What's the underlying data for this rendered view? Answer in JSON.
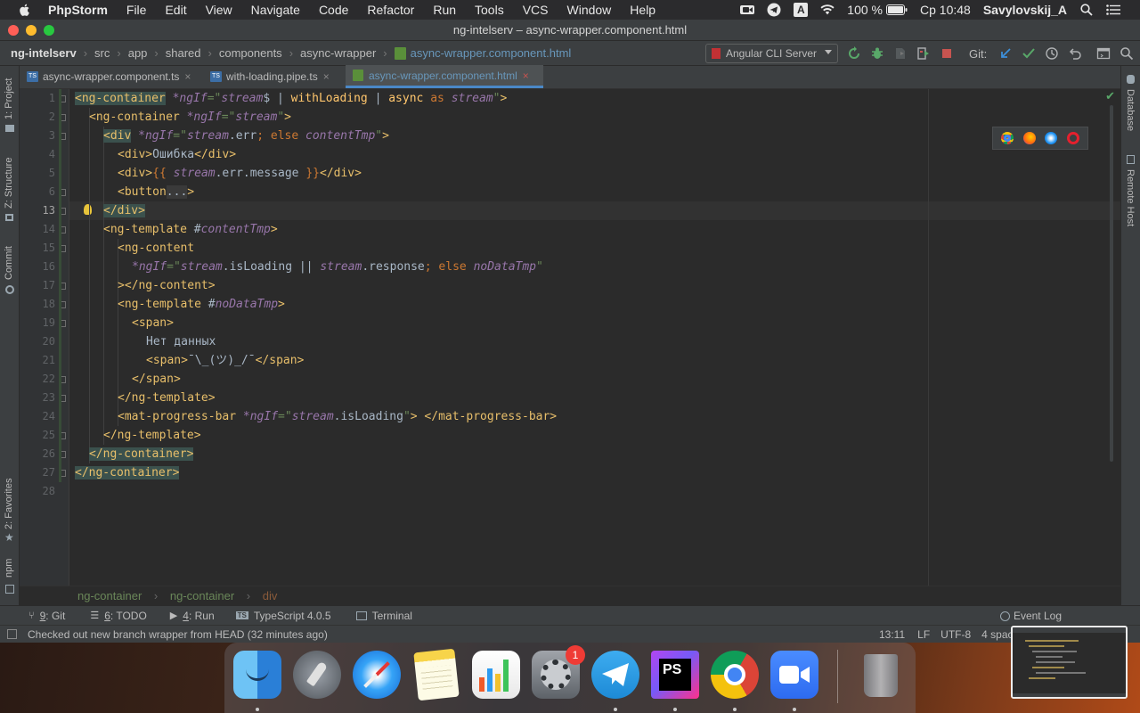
{
  "macos_menubar": {
    "app_name": "PhpStorm",
    "menus": [
      "File",
      "Edit",
      "View",
      "Navigate",
      "Code",
      "Refactor",
      "Run",
      "Tools",
      "VCS",
      "Window",
      "Help"
    ],
    "input_source": "A",
    "battery": "100 %",
    "clock": "Ср 10:48",
    "user": "Savylovskij_A"
  },
  "window": {
    "title": "ng-intelserv – async-wrapper.component.html"
  },
  "navbar": {
    "breadcrumbs": [
      "ng-intelserv",
      "src",
      "app",
      "shared",
      "components",
      "async-wrapper",
      "async-wrapper.component.html"
    ],
    "run_config": "Angular CLI Server",
    "git_label": "Git:"
  },
  "tabs": [
    {
      "label": "async-wrapper.component.ts",
      "type": "ts",
      "active": false
    },
    {
      "label": "with-loading.pipe.ts",
      "type": "ts",
      "active": false
    },
    {
      "label": "async-wrapper.component.html",
      "type": "html",
      "active": true
    }
  ],
  "left_tool_strip": {
    "project": "1: Project",
    "structure": "Z: Structure",
    "commit": "Commit",
    "favorites": "2: Favorites",
    "npm": "npm"
  },
  "right_tool_strip": {
    "database": "Database",
    "remote_host": "Remote Host"
  },
  "editor": {
    "current_line": "13",
    "line_numbers": [
      "1",
      "2",
      "3",
      "4",
      "5",
      "6",
      "13",
      "14",
      "15",
      "16",
      "17",
      "18",
      "19",
      "20",
      "21",
      "22",
      "23",
      "24",
      "25",
      "26",
      "27",
      "28"
    ],
    "code_lines": [
      "<ng-container *ngIf=\"stream$ | withLoading | async as stream\">",
      "  <ng-container *ngIf=\"stream\">",
      "    <div *ngIf=\"stream.err; else contentTmp\">",
      "      <div>Ошибка</div>",
      "      <div>{{ stream.err.message }}</div>",
      "      <button...>",
      "    </div>",
      "    <ng-template #contentTmp>",
      "      <ng-content",
      "        *ngIf=\"stream.isLoading || stream.response; else noDataTmp\"",
      "      ></ng-content>",
      "      <ng-template #noDataTmp>",
      "        <span>",
      "          Нет данных",
      "          <span>¯\\_(ツ)_/¯</span>",
      "        </span>",
      "      </ng-template>",
      "      <mat-progress-bar *ngIf=\"stream.isLoading\"> </mat-progress-bar>",
      "    </ng-template>",
      "  </ng-container>",
      "</ng-container>",
      ""
    ]
  },
  "bottom_breadcrumb": [
    "ng-container",
    "ng-container",
    "div"
  ],
  "tool_windows": [
    {
      "num": "9",
      "label": ": Git",
      "icon": "git-branch-icon"
    },
    {
      "num": "6",
      "label": ": TODO",
      "icon": "todo-list-icon"
    },
    {
      "num": "4",
      "label": ": Run",
      "icon": "run-play-icon"
    },
    {
      "num": "",
      "label": "TypeScript 4.0.5",
      "icon": "typescript-icon"
    },
    {
      "num": "",
      "label": "Terminal",
      "icon": "terminal-icon"
    }
  ],
  "event_log": "Event Log",
  "status": {
    "message": "Checked out new branch wrapper from HEAD (32 minutes ago)",
    "position": "13:11",
    "line_sep": "LF",
    "encoding": "UTF-8",
    "indent": "4 spaces"
  },
  "dock": {
    "apps": [
      "Finder",
      "Launchpad",
      "Safari",
      "Notes",
      "Numbers",
      "System Preferences",
      "Telegram",
      "PhpStorm",
      "Chrome",
      "Zoom",
      "Trash"
    ],
    "badge": "1"
  }
}
